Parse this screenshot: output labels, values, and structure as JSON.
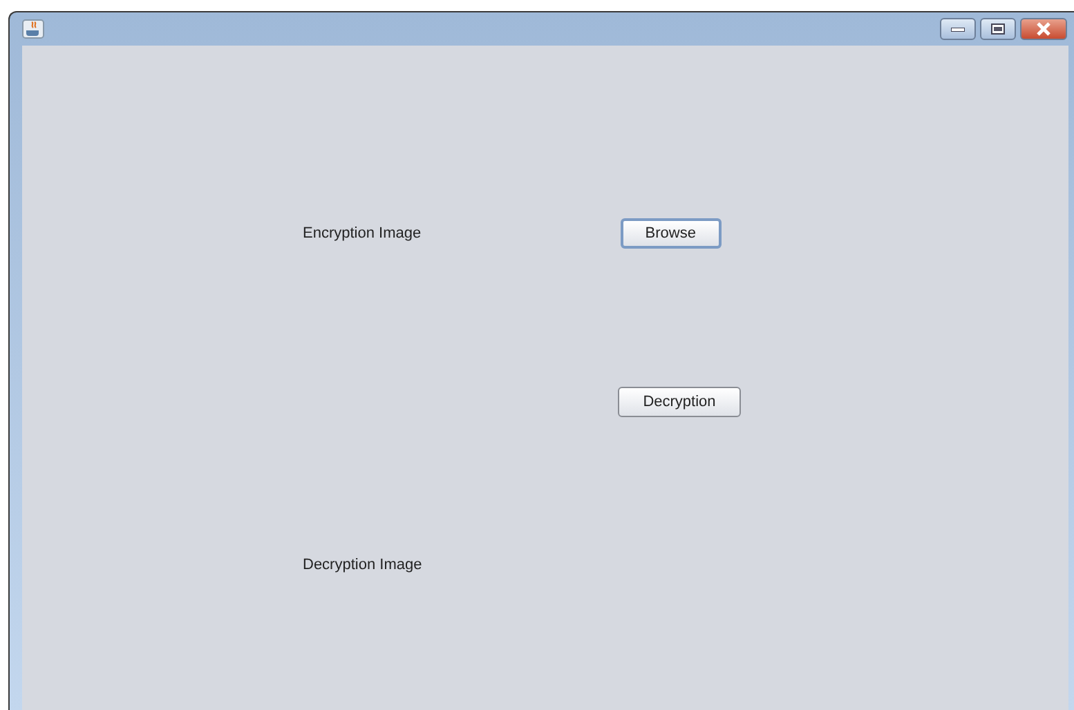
{
  "encryption_label": "Encryption Image",
  "browse_button": {
    "label": "Browse",
    "focused": true
  },
  "decryption_button": {
    "label": "Decryption",
    "focused": false
  },
  "decryption_label": "Decryption Image"
}
